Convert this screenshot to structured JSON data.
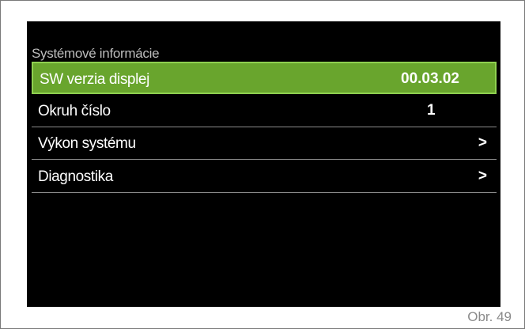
{
  "screen": {
    "title": "Systémové informácie",
    "rows": [
      {
        "label": "SW verzia displej",
        "value": "00.03.02",
        "selected": true
      },
      {
        "label": "Okruh číslo",
        "value": "1"
      },
      {
        "label": "Výkon systému",
        "arrow": ">"
      },
      {
        "label": "Diagnostika",
        "arrow": ">"
      }
    ]
  },
  "figure_label": "Obr. 49",
  "colors": {
    "selected_background": "#69a52d",
    "selected_border": "#8fd050",
    "screen_background": "#000000"
  }
}
